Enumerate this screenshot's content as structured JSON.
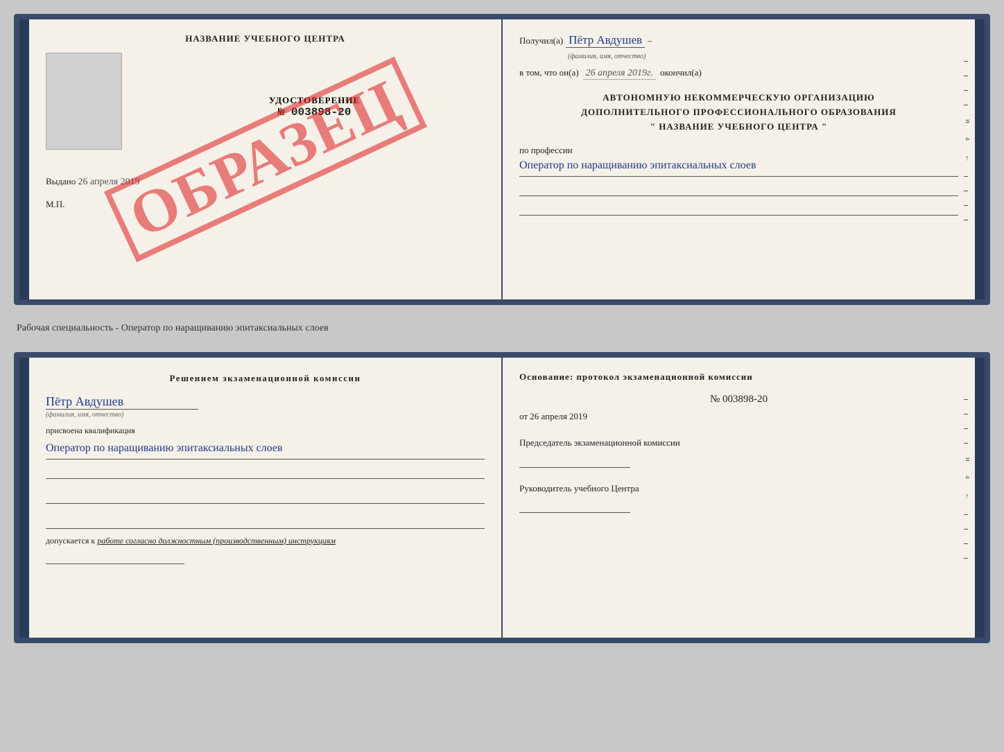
{
  "page": {
    "background": "#c8c8c8"
  },
  "specialty_label": "Рабочая специальность - Оператор по наращиванию эпитаксиальных слоев",
  "upper_book": {
    "left": {
      "title": "НАЗВАНИЕ УЧЕБНОГО ЦЕНТРА",
      "cert_label": "УДОСТОВЕРЕНИЕ",
      "cert_number": "№ 003898-20",
      "issued_text": "Выдано",
      "issued_date": "26 апреля 2019",
      "mp_label": "М.П.",
      "stamp_text": "ОБРАЗЕЦ"
    },
    "right": {
      "recipient_prefix": "Получил(а)",
      "recipient_name": "Пётр Авдушев",
      "recipient_subtitle": "(фамилия, имя, отчество)",
      "dash": "–",
      "date_prefix": "в том, что он(а)",
      "date_value": "26 апреля 2019г.",
      "date_suffix": "окончил(а)",
      "org_line1": "АВТОНОМНУЮ НЕКОММЕРЧЕСКУЮ ОРГАНИЗАЦИЮ",
      "org_line2": "ДОПОЛНИТЕЛЬНОГО ПРОФЕССИОНАЛЬНОГО ОБРАЗОВАНИЯ",
      "org_line3": "\"   НАЗВАНИЕ УЧЕБНОГО ЦЕНТРА   \"",
      "profession_prefix": "по профессии",
      "profession_value": "Оператор по наращиванию эпитаксиальных слоев"
    }
  },
  "lower_book": {
    "left": {
      "decision_title": "Решением  экзаменационной  комиссии",
      "person_name": "Пётр Авдушев",
      "name_subtitle": "(фамилия, имя, отчество)",
      "assigned_prefix": "присвоена квалификация",
      "qualification": "Оператор по наращиванию эпитаксиальных слоев",
      "admission_text": "допускается к",
      "admission_italic": "работе согласно должностным (производственным) инструкциям"
    },
    "right": {
      "basis_text": "Основание:  протокол  экзаменационной  комиссии",
      "protocol_number": "№  003898-20",
      "protocol_date_prefix": "от",
      "protocol_date": "26 апреля 2019",
      "chair_label": "Председатель экзаменационной комиссии",
      "center_head_label": "Руководитель учебного Центра"
    }
  }
}
